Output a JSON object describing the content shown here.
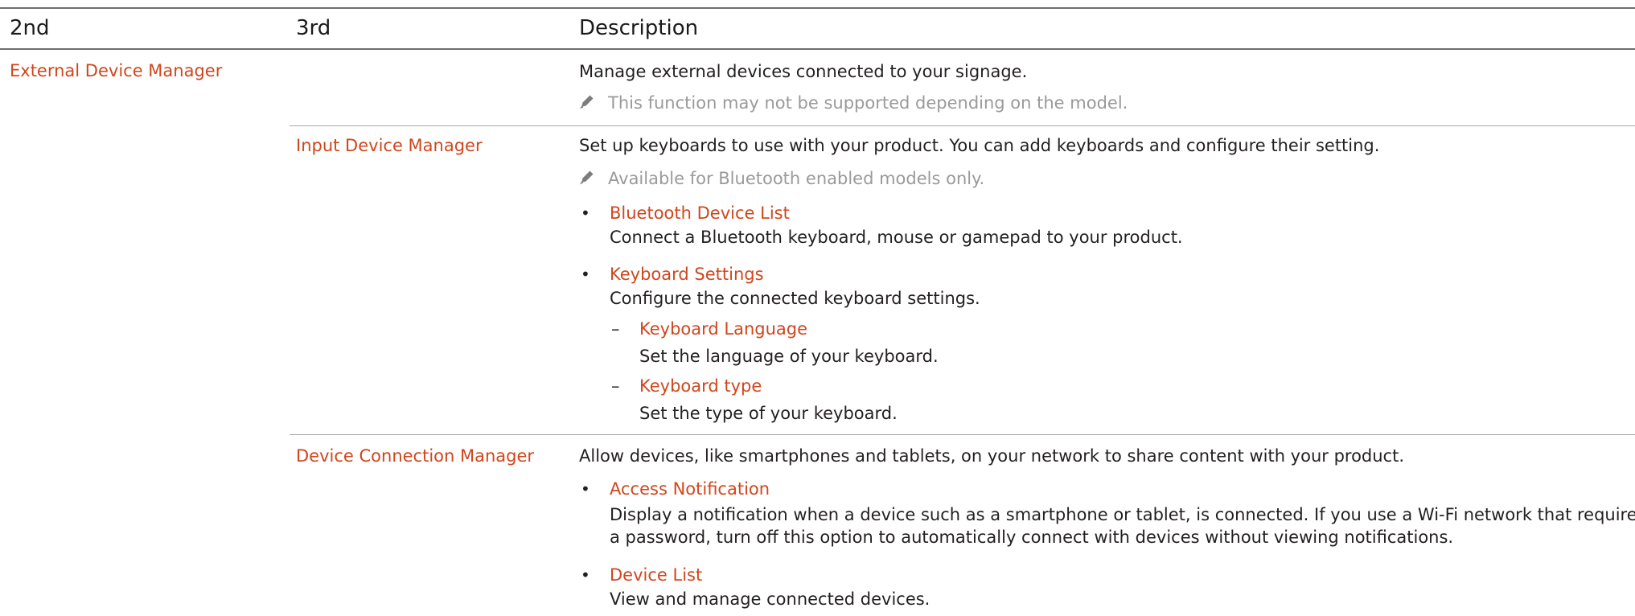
{
  "table": {
    "headers": {
      "col2": "2nd",
      "col3": "3rd",
      "desc": "Description"
    },
    "external": {
      "name": "External Device Manager",
      "desc": "Manage external devices connected to your signage.",
      "note": "This function may not be supported depending on the model."
    },
    "input": {
      "name": "Input Device Manager",
      "desc": "Set up keyboards to use with your product. You can add keyboards and configure their setting.",
      "note": "Available for Bluetooth enabled models only.",
      "bt_title": "Bluetooth Device List",
      "bt_desc": "Connect a Bluetooth keyboard, mouse or gamepad to your product.",
      "kb_title": "Keyboard Settings",
      "kb_desc": "Configure the connected keyboard settings.",
      "lang_title": "Keyboard Language",
      "lang_desc": "Set the language of your keyboard.",
      "type_title": "Keyboard type",
      "type_desc": "Set the type of your keyboard."
    },
    "connection": {
      "name": "Device Connection Manager",
      "desc": "Allow devices, like smartphones and tablets, on your network to share content with your product.",
      "access_title": "Access Notification",
      "access_desc1": "Display a notification when a device such as a smartphone or tablet, is connected. If you use a Wi-Fi network that requires",
      "access_desc2": "a password, turn off this option to automatically connect with devices without viewing notifications.",
      "list_title": "Device List",
      "list_desc": "View and manage connected devices."
    }
  },
  "colors": {
    "accent": "#d0461d",
    "text": "#231f20",
    "note": "#9a9a9a",
    "rule": "#6e6e6e"
  },
  "icons": {
    "note_icon": "pencil-icon",
    "bullet": "•",
    "dash": "–"
  }
}
